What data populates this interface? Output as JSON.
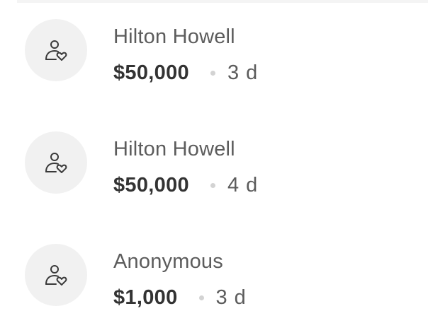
{
  "donations": [
    {
      "name": "Hilton Howell",
      "amount": "$50,000",
      "time": "3 d",
      "icon": "person-heart-icon"
    },
    {
      "name": "Hilton Howell",
      "amount": "$50,000",
      "time": "4 d",
      "icon": "person-heart-icon"
    },
    {
      "name": "Anonymous",
      "amount": "$1,000",
      "time": "3 d",
      "icon": "person-heart-icon"
    }
  ],
  "colors": {
    "avatar_bg": "#f1f1f1",
    "name_text": "#5c5c5c",
    "amount_text": "#333333",
    "separator_dot": "#d3d3d3"
  }
}
